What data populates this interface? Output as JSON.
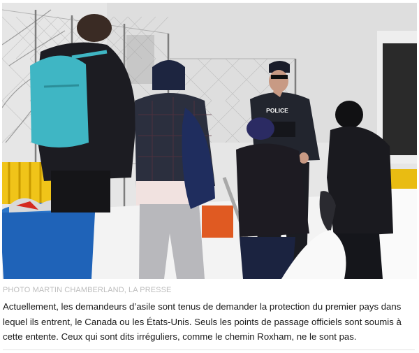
{
  "figure": {
    "photo_credit": "PHOTO MARTIN CHAMBERLAND, LA PRESSE",
    "caption": "Actuellement, les demandeurs d’asile sont tenus de demander la protection du premier pays dans lequel ils entrent, le Canada ou les États-Unis. Seuls les points de passage officiels sont soumis à cette entente. Ceux qui sont dits irréguliers, comme le chemin Roxham, ne le sont pas.",
    "police_label": "POLICE"
  },
  "colors": {
    "sky": "#e7e7e7",
    "snow": "#f4f4f4",
    "building": "#dcdcdc",
    "fence": "#9a9a9a",
    "teal_backpack": "#3fb6c4",
    "blue_bin": "#1f63b8",
    "yellow_barrier": "#f0c419",
    "red": "#d42a1f",
    "dark_jacket": "#1e1f25",
    "plaid_jacket": "#2b2f3e",
    "grey_pants": "#b8b8bc",
    "navy": "#1d2540"
  }
}
